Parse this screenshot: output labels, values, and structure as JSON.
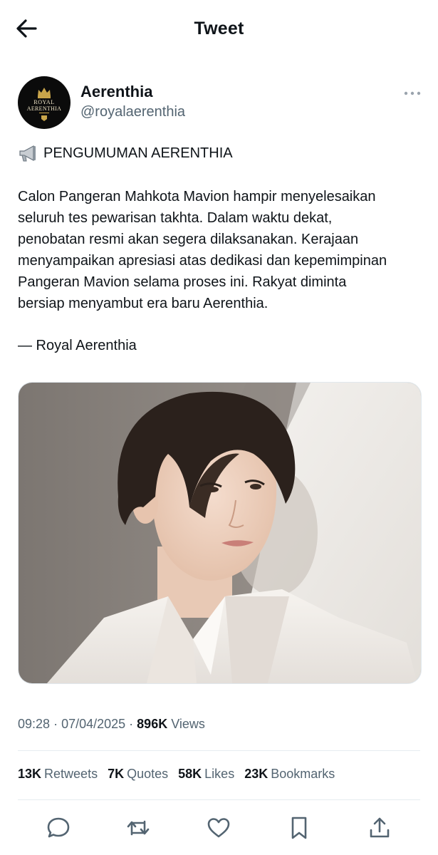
{
  "header": {
    "title": "Tweet",
    "back_icon": "arrow-left-icon"
  },
  "author": {
    "display_name": "Aerenthia",
    "handle": "@royalaerenthia",
    "avatar_text_line1": "ROYAL",
    "avatar_text_line2": "AERENTHIA",
    "avatar_icon": "crown-icon"
  },
  "tweet": {
    "announcement_icon": "megaphone-icon",
    "announcement": "PENGUMUMAN AERENTHIA",
    "body": "Calon Pangeran Mahkota Mavion hampir menyelesaikan\nseluruh tes pewarisan takhta. Dalam waktu dekat,\npenobatan resmi akan segera dilaksanakan. Kerajaan\nmenyampaikan apresiasi atas dedikasi dan kepemimpinan\nPangeran Mavion selama proses ini. Rakyat diminta\nbersiap menyambut era baru Aerenthia.",
    "signature": "— Royal Aerenthia"
  },
  "meta": {
    "time": "09:28",
    "date": "07/04/2025",
    "views_count": "896K",
    "views_label": "Views"
  },
  "stats": [
    {
      "count": "13K",
      "label": "Retweets"
    },
    {
      "count": "7K",
      "label": "Quotes"
    },
    {
      "count": "58K",
      "label": "Likes"
    },
    {
      "count": "23K",
      "label": "Bookmarks"
    }
  ],
  "actions": [
    "reply-icon",
    "retweet-icon",
    "like-icon",
    "bookmark-icon",
    "share-icon"
  ],
  "colors": {
    "text": "#0f1419",
    "secondary": "#536471",
    "divider": "#e6ecf0",
    "avatar_bg": "#0b0b0b",
    "gold": "#c9a54a"
  }
}
